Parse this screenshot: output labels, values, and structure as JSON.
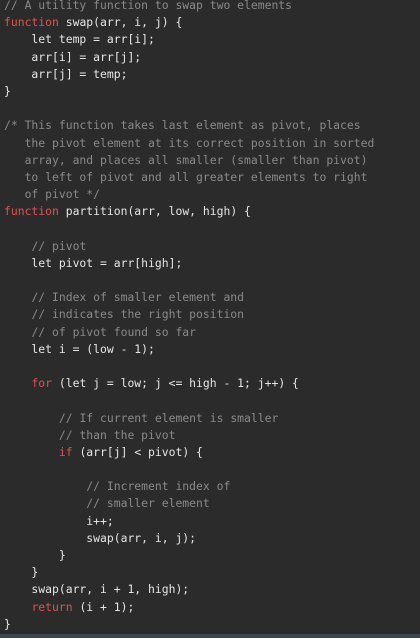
{
  "editor": {
    "language": "javascript",
    "colors": {
      "background": "#2b2b2b",
      "text": "#e6e6e6",
      "comment": "#8a8a8a",
      "keyword": "#e0524f"
    },
    "lines": [
      [
        {
          "t": "c",
          "s": "// A utility function to swap two elements"
        }
      ],
      [
        {
          "t": "k",
          "s": "function"
        },
        {
          "t": "n",
          "s": " swap(arr, i, j) {"
        }
      ],
      [
        {
          "t": "n",
          "s": "    let temp = arr[i];"
        }
      ],
      [
        {
          "t": "n",
          "s": "    arr[i] = arr[j];"
        }
      ],
      [
        {
          "t": "n",
          "s": "    arr[j] = temp;"
        }
      ],
      [
        {
          "t": "n",
          "s": "}"
        }
      ],
      [
        {
          "t": "n",
          "s": ""
        }
      ],
      [
        {
          "t": "c",
          "s": "/* This function takes last element as pivot, places"
        }
      ],
      [
        {
          "t": "c",
          "s": "   the pivot element at its correct position in sorted"
        }
      ],
      [
        {
          "t": "c",
          "s": "   array, and places all smaller (smaller than pivot)"
        }
      ],
      [
        {
          "t": "c",
          "s": "   to left of pivot and all greater elements to right"
        }
      ],
      [
        {
          "t": "c",
          "s": "   of pivot */"
        }
      ],
      [
        {
          "t": "k",
          "s": "function"
        },
        {
          "t": "n",
          "s": " partition(arr, low, high) {"
        }
      ],
      [
        {
          "t": "n",
          "s": ""
        }
      ],
      [
        {
          "t": "n",
          "s": "    "
        },
        {
          "t": "c",
          "s": "// pivot"
        }
      ],
      [
        {
          "t": "n",
          "s": "    let pivot = arr[high];"
        }
      ],
      [
        {
          "t": "n",
          "s": ""
        }
      ],
      [
        {
          "t": "n",
          "s": "    "
        },
        {
          "t": "c",
          "s": "// Index of smaller element and"
        }
      ],
      [
        {
          "t": "n",
          "s": "    "
        },
        {
          "t": "c",
          "s": "// indicates the right position"
        }
      ],
      [
        {
          "t": "n",
          "s": "    "
        },
        {
          "t": "c",
          "s": "// of pivot found so far"
        }
      ],
      [
        {
          "t": "n",
          "s": "    let i = (low - 1);"
        }
      ],
      [
        {
          "t": "n",
          "s": ""
        }
      ],
      [
        {
          "t": "n",
          "s": "    "
        },
        {
          "t": "k",
          "s": "for"
        },
        {
          "t": "n",
          "s": " (let j = low; j <= high - 1; j++) {"
        }
      ],
      [
        {
          "t": "n",
          "s": ""
        }
      ],
      [
        {
          "t": "n",
          "s": "        "
        },
        {
          "t": "c",
          "s": "// If current element is smaller"
        }
      ],
      [
        {
          "t": "n",
          "s": "        "
        },
        {
          "t": "c",
          "s": "// than the pivot"
        }
      ],
      [
        {
          "t": "n",
          "s": "        "
        },
        {
          "t": "k",
          "s": "if"
        },
        {
          "t": "n",
          "s": " (arr[j] < pivot) {"
        }
      ],
      [
        {
          "t": "n",
          "s": ""
        }
      ],
      [
        {
          "t": "n",
          "s": "            "
        },
        {
          "t": "c",
          "s": "// Increment index of"
        }
      ],
      [
        {
          "t": "n",
          "s": "            "
        },
        {
          "t": "c",
          "s": "// smaller element"
        }
      ],
      [
        {
          "t": "n",
          "s": "            i++;"
        }
      ],
      [
        {
          "t": "n",
          "s": "            swap(arr, i, j);"
        }
      ],
      [
        {
          "t": "n",
          "s": "        }"
        }
      ],
      [
        {
          "t": "n",
          "s": "    }"
        }
      ],
      [
        {
          "t": "n",
          "s": "    swap(arr, i + 1, high);"
        }
      ],
      [
        {
          "t": "n",
          "s": "    "
        },
        {
          "t": "k",
          "s": "return"
        },
        {
          "t": "n",
          "s": " (i + 1);"
        }
      ],
      [
        {
          "t": "n",
          "s": "}"
        }
      ]
    ]
  }
}
